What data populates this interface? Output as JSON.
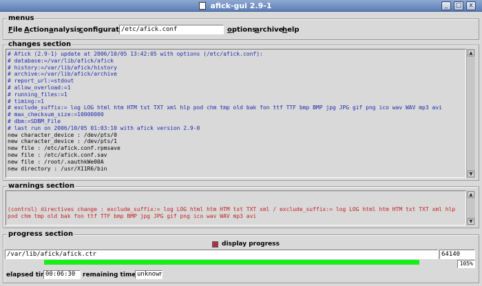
{
  "window": {
    "title": "afick-gui 2.9-1",
    "buttons": [
      "_",
      "□",
      "x"
    ]
  },
  "menus_section": {
    "label": "menus",
    "items": [
      {
        "key": "F",
        "rest": "ile"
      },
      {
        "key": "A",
        "rest": "ction"
      },
      {
        "key": "a",
        "rest": "nalysis"
      },
      {
        "key": "c",
        "rest": "onfiguration"
      }
    ],
    "config_path": "/etc/afick.conf",
    "right_items": [
      {
        "key": "o",
        "rest": "ptions"
      },
      {
        "key": "a",
        "rest": "rchive"
      },
      {
        "key": "h",
        "rest": "elp"
      }
    ]
  },
  "changes_section": {
    "label": "changes section",
    "lines": [
      {
        "type": "comment",
        "text": "# Afick (2.9-1) update at 2006/10/05 13:42:05 with options (/etc/afick.conf):"
      },
      {
        "type": "comment",
        "text": "# database:=/var/lib/afick/afick"
      },
      {
        "type": "comment",
        "text": "# history:=/var/lib/afick/history"
      },
      {
        "type": "comment",
        "text": "# archive:=/var/lib/afick/archive"
      },
      {
        "type": "comment",
        "text": "# report_url:=stdout"
      },
      {
        "type": "comment",
        "text": "# allow_overload:=1"
      },
      {
        "type": "comment",
        "text": "# running_files:=1"
      },
      {
        "type": "comment",
        "text": "# timing:=1"
      },
      {
        "type": "comment",
        "text": "# exclude_suffix:= log LOG html htm HTM txt TXT xml hlp pod chm tmp old bak fon ttf TTF bmp BMP jpg JPG gif png ico wav WAV mp3 avi"
      },
      {
        "type": "comment",
        "text": "# max_checksum_size:=10000000"
      },
      {
        "type": "comment",
        "text": "# dbm:=SDBM_File"
      },
      {
        "type": "comment",
        "text": "# last run on 2006/10/05 01:03:10 with afick version 2.9-0"
      },
      {
        "type": "normal",
        "text": "new character_device : /dev/pts/0"
      },
      {
        "type": "normal",
        "text": "new character_device : /dev/pts/1"
      },
      {
        "type": "normal",
        "text": "new file : /etc/afick.conf.rpmsave"
      },
      {
        "type": "normal",
        "text": "new file : /etc/afick.conf.sav"
      },
      {
        "type": "normal",
        "text": "new file : /root/.xauthkWe00A"
      },
      {
        "type": "normal",
        "text": "new directory : /usr/X11R6/bin"
      }
    ]
  },
  "warnings_section": {
    "label": "warnings section",
    "text": "(control) directives change : exclude_suffix:= log LOG html htm HTM txt TXT xml / exclude_suffix:= log LOG html htm HTM txt TXT xml hlp pod chm tmp old bak fon ttf TTF bmp BMP jpg JPG gif png ico wav WAV mp3 avi"
  },
  "progress_section": {
    "label": "progress section",
    "display_progress_label": "display progress",
    "display_progress_checked": true,
    "current_file": "/var/lib/afick/afick.ctr",
    "count": "64140",
    "percent": "105%",
    "elapsed_label": "elapsed time",
    "elapsed_value": "00:06:30",
    "remaining_label": "remaining time",
    "remaining_value": "unknown"
  },
  "colors": {
    "comment": "#1c2ab0",
    "warning": "#c42020",
    "progress": "#1aee1a",
    "checkbox": "#b03040"
  }
}
